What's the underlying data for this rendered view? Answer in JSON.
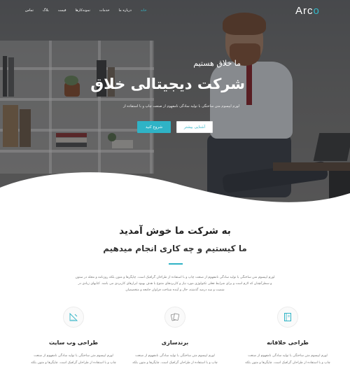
{
  "brand": {
    "logo_main": "Arc",
    "logo_accent": "o"
  },
  "nav": {
    "items": [
      {
        "label": "تماس"
      },
      {
        "label": "بلاگ"
      },
      {
        "label": "قیمت"
      },
      {
        "label": "نمونه‌کارها"
      },
      {
        "label": "خدمات"
      },
      {
        "label": "درباره ما"
      },
      {
        "label": "خانه",
        "active": true
      }
    ]
  },
  "hero": {
    "eyebrow": "ما خلاق هستیم",
    "headline": "شرکت دیجیتالی خلاق",
    "lead": "لورم ایپسوم متن ساختگی با تولید سادگی نامفهوم از صنعت چاپ و با استفاده از",
    "primary_button": "شروع کنید",
    "secondary_button": "آشنایی بیشتر"
  },
  "welcome": {
    "title": "به شرکت ما خوش آمدید",
    "subtitle": "ما کیستیم و چه کاری انجام میدهیم",
    "body_lines": [
      "لورم ایپسوم متن ساختگی با تولید سادگی نامفهوم از صنعت چاپ و با استفاده از طراحان گرافیک است. چاپگرها و متون بلکه روزنامه و مجله در ستون",
      "و سطرآنچنان که لازم است و برای شرایط فعلی تکنولوژی مورد نیاز و کاربردهای متنوع با هدف بهبود ابزارهای کاربردی می باشد. کتابهای زیادی در",
      "شصت و سه درصد گذشته، حال و آینده شناخت فراوان جامعه و متخصصان"
    ]
  },
  "features": [
    {
      "icon": "book-icon",
      "title": "طراحی خلاقانه",
      "body_lines": [
        "لورم ایپسوم متن ساختگی با تولید سادگی نامفهوم از صنعت",
        "چاپ و با استفاده از طراحان گرافیک است. چاپگرها و متون بلکه"
      ]
    },
    {
      "icon": "cards-icon",
      "title": "برندسازی",
      "body_lines": [
        "لورم ایپسوم متن ساختگی با تولید سادگی نامفهوم از صنعت",
        "چاپ و با استفاده از طراحان گرافیک است. چاپگرها و متون بلکه"
      ]
    },
    {
      "icon": "ruler-pen-icon",
      "title": "طراحی وب سایت",
      "body_lines": [
        "لورم ایپسوم متن ساختگی با تولید سادگی نامفهوم از صنعت",
        "چاپ و با استفاده از طراحان گرافیک است. چاپگرها و متون بلکه"
      ]
    }
  ],
  "colors": {
    "accent": "#2fb3c6",
    "heading": "#222222",
    "body_text": "#777777"
  }
}
